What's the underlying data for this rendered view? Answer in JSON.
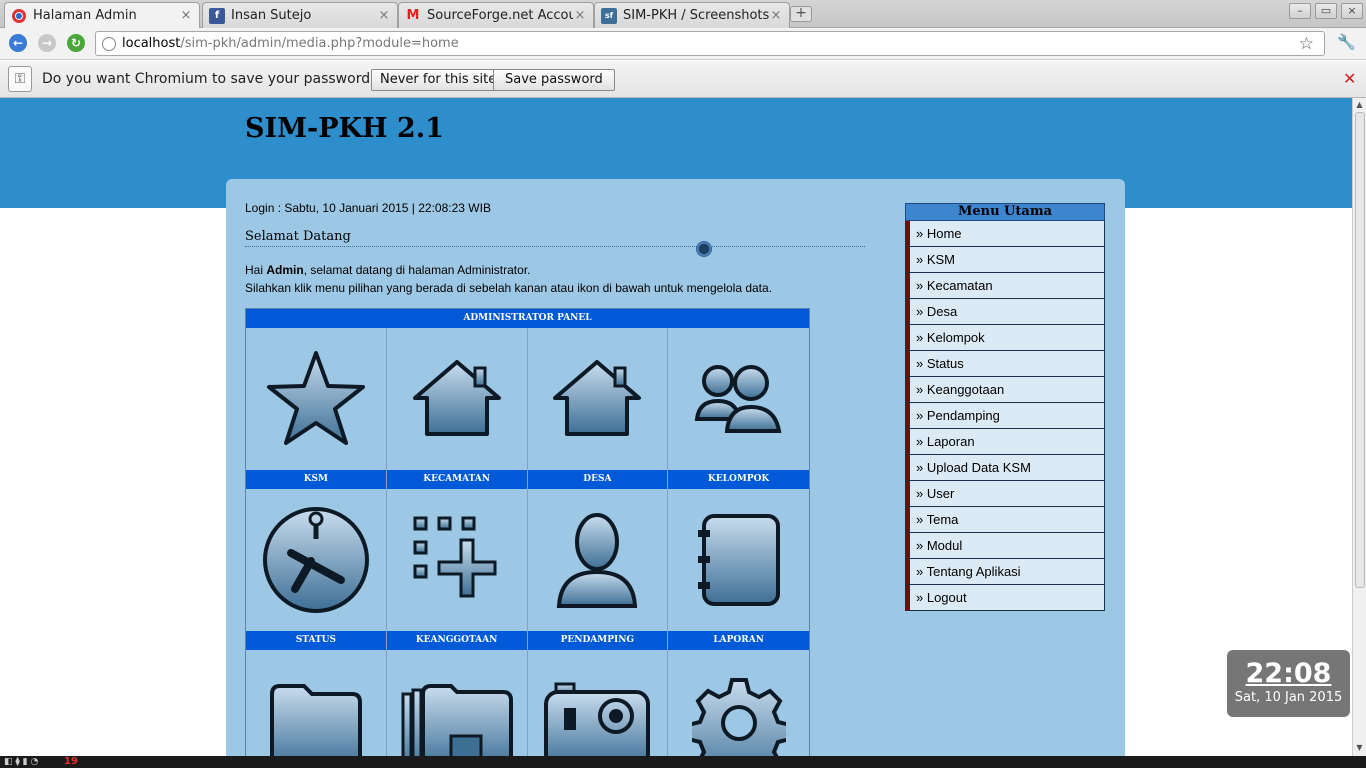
{
  "browser": {
    "tabs": [
      {
        "title": "Halaman Admin",
        "icon": "chromium-icon",
        "active": true
      },
      {
        "title": "Insan Sutejo",
        "icon": "facebook-icon",
        "active": false
      },
      {
        "title": "SourceForge.net Accou",
        "icon": "gmail-icon",
        "active": false
      },
      {
        "title": "SIM-PKH / Screenshots",
        "icon": "sourceforge-icon",
        "active": false
      }
    ],
    "url_host": "localhost",
    "url_path": "/sim-pkh/admin/media.php?module=home",
    "infobar": {
      "message": "Do you want Chromium to save your password?",
      "never_label": "Never for this site",
      "save_label": "Save password"
    }
  },
  "site": {
    "title": "SIM-PKH 2.1",
    "login_info": "Login : Sabtu, 10 Januari 2015 | 22:08:23 WIB",
    "welcome_heading": "Selamat Datang",
    "greeting_prefix": "Hai ",
    "greeting_name": "Admin",
    "greeting_suffix": ", selamat datang di halaman Administrator.",
    "instruction": "Silahkan klik menu pilihan yang berada di sebelah kanan atau ikon di bawah untuk mengelola data."
  },
  "panel": {
    "title": "ADMINISTRATOR PANEL",
    "rows": [
      [
        {
          "label": "KSM",
          "icon": "star-icon"
        },
        {
          "label": "KECAMATAN",
          "icon": "house-icon"
        },
        {
          "label": "DESA",
          "icon": "house-icon"
        },
        {
          "label": "KELOMPOK",
          "icon": "users-icon"
        }
      ],
      [
        {
          "label": "STATUS",
          "icon": "clock-icon"
        },
        {
          "label": "KEANGGOTAAN",
          "icon": "grid-add-icon"
        },
        {
          "label": "PENDAMPING",
          "icon": "user-icon"
        },
        {
          "label": "LAPORAN",
          "icon": "notebook-icon"
        }
      ],
      [
        {
          "label": "",
          "icon": "folder-icon"
        },
        {
          "label": "",
          "icon": "folders-icon"
        },
        {
          "label": "",
          "icon": "camera-icon"
        },
        {
          "label": "",
          "icon": "gear-icon"
        }
      ]
    ]
  },
  "menu": {
    "title": "Menu Utama",
    "items": [
      "» Home",
      "» KSM",
      "» Kecamatan",
      "» Desa",
      "» Kelompok",
      "» Status",
      "» Keanggotaan",
      "» Pendamping",
      "» Laporan",
      "» Upload Data KSM",
      "» User",
      "» Tema",
      "» Modul",
      "» Tentang Aplikasi",
      "» Logout"
    ]
  },
  "clock": {
    "time": "22:08",
    "date": "Sat, 10 Jan 2015"
  },
  "taskbar": {
    "badge": "19"
  },
  "colors": {
    "banner": "#2e8ecc",
    "content_bg": "#9dc8e5",
    "panel_header": "#0059d6",
    "menu_accent": "#6b0f0f"
  }
}
